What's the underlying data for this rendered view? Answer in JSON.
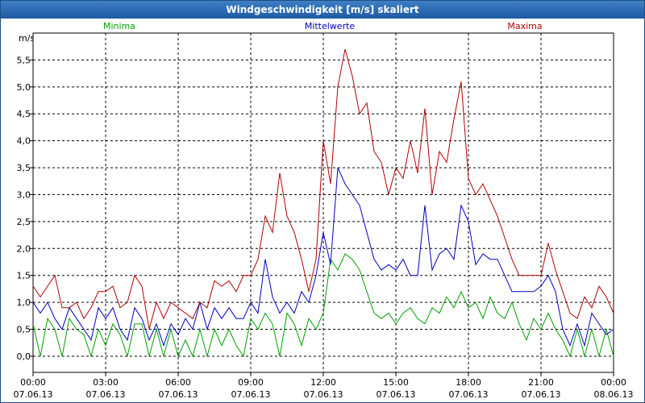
{
  "window": {
    "title": "Windgeschwindigkeit [m/s] skaliert"
  },
  "chart_data": {
    "type": "line",
    "title": "Windgeschwindigkeit [m/s] skaliert",
    "ylabel": "m/s",
    "ylim": [
      -0.3,
      6.0
    ],
    "y_ticks": [
      "0,0",
      "0,5",
      "1,0",
      "1,5",
      "2,0",
      "2,5",
      "3,0",
      "3,5",
      "4,0",
      "4,5",
      "5,0",
      "5,5"
    ],
    "y_tick_values": [
      0,
      0.5,
      1,
      1.5,
      2,
      2.5,
      3,
      3.5,
      4,
      4.5,
      5,
      5.5
    ],
    "x_ticks": [
      {
        "hours": 0,
        "time": "00:00",
        "date": "07.06.13"
      },
      {
        "hours": 3,
        "time": "03:00",
        "date": "07.06.13"
      },
      {
        "hours": 6,
        "time": "06:00",
        "date": "07.06.13"
      },
      {
        "hours": 9,
        "time": "09:00",
        "date": "07.06.13"
      },
      {
        "hours": 12,
        "time": "12:00",
        "date": "07.06.13"
      },
      {
        "hours": 15,
        "time": "15:00",
        "date": "07.06.13"
      },
      {
        "hours": 18,
        "time": "18:00",
        "date": "07.06.13"
      },
      {
        "hours": 21,
        "time": "21:00",
        "date": "07.06.13"
      },
      {
        "hours": 24,
        "time": "00:00",
        "date": "08.06.13"
      }
    ],
    "xlim": [
      0,
      24
    ],
    "grid": true,
    "legend_position": "top",
    "series": [
      {
        "name": "Minima",
        "color": "#00a000",
        "points": [
          [
            0,
            0.6
          ],
          [
            0.3,
            0
          ],
          [
            0.6,
            0.7
          ],
          [
            0.9,
            0.5
          ],
          [
            1.2,
            0
          ],
          [
            1.5,
            0.7
          ],
          [
            1.8,
            0.5
          ],
          [
            2.1,
            0.4
          ],
          [
            2.4,
            0
          ],
          [
            2.7,
            0.5
          ],
          [
            3,
            0.2
          ],
          [
            3.3,
            0.6
          ],
          [
            3.6,
            0.4
          ],
          [
            3.9,
            0
          ],
          [
            4.2,
            0.6
          ],
          [
            4.5,
            0.6
          ],
          [
            4.8,
            0
          ],
          [
            5.1,
            0.5
          ],
          [
            5.4,
            0
          ],
          [
            5.7,
            0.5
          ],
          [
            6,
            0
          ],
          [
            6.3,
            0.3
          ],
          [
            6.6,
            0
          ],
          [
            6.9,
            0.5
          ],
          [
            7.2,
            0
          ],
          [
            7.5,
            0.5
          ],
          [
            7.8,
            0.2
          ],
          [
            8.1,
            0.5
          ],
          [
            8.4,
            0.2
          ],
          [
            8.7,
            0
          ],
          [
            9,
            0.7
          ],
          [
            9.3,
            0.5
          ],
          [
            9.6,
            0.8
          ],
          [
            9.9,
            0.6
          ],
          [
            10.2,
            0
          ],
          [
            10.5,
            0.8
          ],
          [
            10.8,
            0.6
          ],
          [
            11.1,
            0.2
          ],
          [
            11.4,
            0.7
          ],
          [
            11.7,
            0.5
          ],
          [
            12,
            0.8
          ],
          [
            12.3,
            1.8
          ],
          [
            12.6,
            1.6
          ],
          [
            12.9,
            1.9
          ],
          [
            13.2,
            1.8
          ],
          [
            13.5,
            1.6
          ],
          [
            13.8,
            1.2
          ],
          [
            14.1,
            0.8
          ],
          [
            14.4,
            0.7
          ],
          [
            14.7,
            0.8
          ],
          [
            15,
            0.6
          ],
          [
            15.3,
            0.8
          ],
          [
            15.6,
            0.9
          ],
          [
            15.9,
            0.7
          ],
          [
            16.2,
            0.6
          ],
          [
            16.5,
            0.9
          ],
          [
            16.8,
            0.8
          ],
          [
            17.1,
            1.1
          ],
          [
            17.4,
            0.9
          ],
          [
            17.7,
            1.2
          ],
          [
            18,
            0.9
          ],
          [
            18.3,
            1.0
          ],
          [
            18.6,
            0.7
          ],
          [
            18.9,
            1.1
          ],
          [
            19.2,
            0.8
          ],
          [
            19.5,
            0.7
          ],
          [
            19.8,
            1.0
          ],
          [
            20.1,
            0.6
          ],
          [
            20.4,
            0.3
          ],
          [
            20.7,
            0.7
          ],
          [
            21,
            0.5
          ],
          [
            21.3,
            0.8
          ],
          [
            21.6,
            0.5
          ],
          [
            21.9,
            0.3
          ],
          [
            22.2,
            0
          ],
          [
            22.5,
            0.5
          ],
          [
            22.8,
            0
          ],
          [
            23.1,
            0.5
          ],
          [
            23.4,
            0
          ],
          [
            23.7,
            0.5
          ],
          [
            24,
            0
          ]
        ]
      },
      {
        "name": "Mittelwerte",
        "color": "#0000c0",
        "points": [
          [
            0,
            1.0
          ],
          [
            0.3,
            0.8
          ],
          [
            0.6,
            1.0
          ],
          [
            0.9,
            0.7
          ],
          [
            1.2,
            0.5
          ],
          [
            1.5,
            0.9
          ],
          [
            1.8,
            0.7
          ],
          [
            2.1,
            0.5
          ],
          [
            2.4,
            0.3
          ],
          [
            2.7,
            0.9
          ],
          [
            3,
            0.7
          ],
          [
            3.3,
            0.9
          ],
          [
            3.6,
            0.5
          ],
          [
            3.9,
            0.3
          ],
          [
            4.2,
            0.9
          ],
          [
            4.5,
            0.7
          ],
          [
            4.8,
            0.3
          ],
          [
            5.1,
            0.6
          ],
          [
            5.4,
            0.2
          ],
          [
            5.7,
            0.6
          ],
          [
            6,
            0.4
          ],
          [
            6.3,
            0.7
          ],
          [
            6.6,
            0.5
          ],
          [
            6.9,
            1.0
          ],
          [
            7.2,
            0.5
          ],
          [
            7.5,
            0.9
          ],
          [
            7.8,
            0.7
          ],
          [
            8.1,
            0.9
          ],
          [
            8.4,
            0.7
          ],
          [
            8.7,
            0.7
          ],
          [
            9,
            1.0
          ],
          [
            9.3,
            0.8
          ],
          [
            9.6,
            1.8
          ],
          [
            9.9,
            1.1
          ],
          [
            10.2,
            0.8
          ],
          [
            10.5,
            1.0
          ],
          [
            10.8,
            0.8
          ],
          [
            11.1,
            1.2
          ],
          [
            11.4,
            1.0
          ],
          [
            11.7,
            1.5
          ],
          [
            12,
            2.3
          ],
          [
            12.3,
            1.7
          ],
          [
            12.6,
            3.5
          ],
          [
            12.9,
            3.2
          ],
          [
            13.2,
            3.0
          ],
          [
            13.5,
            2.8
          ],
          [
            13.8,
            2.3
          ],
          [
            14.1,
            1.8
          ],
          [
            14.4,
            1.6
          ],
          [
            14.7,
            1.7
          ],
          [
            15,
            1.6
          ],
          [
            15.3,
            1.8
          ],
          [
            15.6,
            1.5
          ],
          [
            15.9,
            1.5
          ],
          [
            16.2,
            2.8
          ],
          [
            16.5,
            1.6
          ],
          [
            16.8,
            1.9
          ],
          [
            17.1,
            2.0
          ],
          [
            17.4,
            1.8
          ],
          [
            17.7,
            2.8
          ],
          [
            18,
            2.5
          ],
          [
            18.3,
            1.7
          ],
          [
            18.6,
            1.9
          ],
          [
            18.9,
            1.8
          ],
          [
            19.2,
            1.8
          ],
          [
            19.5,
            1.5
          ],
          [
            19.8,
            1.2
          ],
          [
            20.1,
            1.2
          ],
          [
            20.4,
            1.2
          ],
          [
            20.7,
            1.2
          ],
          [
            21,
            1.3
          ],
          [
            21.3,
            1.5
          ],
          [
            21.6,
            1.2
          ],
          [
            21.9,
            0.5
          ],
          [
            22.2,
            0.2
          ],
          [
            22.5,
            0.6
          ],
          [
            22.8,
            0.2
          ],
          [
            23.1,
            0.8
          ],
          [
            23.4,
            0.6
          ],
          [
            23.7,
            0.4
          ],
          [
            24,
            0.5
          ]
        ]
      },
      {
        "name": "Maxima",
        "color": "#b00000",
        "points": [
          [
            0,
            1.3
          ],
          [
            0.3,
            1.1
          ],
          [
            0.6,
            1.3
          ],
          [
            0.9,
            1.5
          ],
          [
            1.2,
            0.9
          ],
          [
            1.5,
            0.9
          ],
          [
            1.8,
            1.0
          ],
          [
            2.1,
            0.7
          ],
          [
            2.4,
            0.9
          ],
          [
            2.7,
            1.2
          ],
          [
            3,
            1.2
          ],
          [
            3.3,
            1.3
          ],
          [
            3.6,
            0.9
          ],
          [
            3.9,
            1.0
          ],
          [
            4.2,
            1.5
          ],
          [
            4.5,
            1.3
          ],
          [
            4.8,
            0.5
          ],
          [
            5.1,
            1.0
          ],
          [
            5.4,
            0.7
          ],
          [
            5.7,
            1.0
          ],
          [
            6,
            0.9
          ],
          [
            6.3,
            0.8
          ],
          [
            6.6,
            0.7
          ],
          [
            6.9,
            1.0
          ],
          [
            7.2,
            0.9
          ],
          [
            7.5,
            1.4
          ],
          [
            7.8,
            1.3
          ],
          [
            8.1,
            1.4
          ],
          [
            8.4,
            1.2
          ],
          [
            8.7,
            1.5
          ],
          [
            9,
            1.5
          ],
          [
            9.3,
            1.8
          ],
          [
            9.6,
            2.6
          ],
          [
            9.9,
            2.3
          ],
          [
            10.2,
            3.4
          ],
          [
            10.5,
            2.6
          ],
          [
            10.8,
            2.3
          ],
          [
            11.1,
            1.8
          ],
          [
            11.4,
            1.2
          ],
          [
            11.7,
            1.8
          ],
          [
            12,
            4.0
          ],
          [
            12.3,
            3.2
          ],
          [
            12.6,
            5.0
          ],
          [
            12.9,
            5.7
          ],
          [
            13.2,
            5.2
          ],
          [
            13.5,
            4.5
          ],
          [
            13.8,
            4.7
          ],
          [
            14.1,
            3.8
          ],
          [
            14.4,
            3.6
          ],
          [
            14.7,
            3.0
          ],
          [
            15,
            3.5
          ],
          [
            15.3,
            3.3
          ],
          [
            15.6,
            4.0
          ],
          [
            15.9,
            3.4
          ],
          [
            16.2,
            4.6
          ],
          [
            16.5,
            3.0
          ],
          [
            16.8,
            3.8
          ],
          [
            17.1,
            3.6
          ],
          [
            17.4,
            4.4
          ],
          [
            17.7,
            5.1
          ],
          [
            18,
            3.3
          ],
          [
            18.3,
            3.0
          ],
          [
            18.6,
            3.2
          ],
          [
            18.9,
            2.9
          ],
          [
            19.2,
            2.6
          ],
          [
            19.5,
            2.2
          ],
          [
            19.8,
            1.8
          ],
          [
            20.1,
            1.5
          ],
          [
            20.4,
            1.5
          ],
          [
            20.7,
            1.5
          ],
          [
            21,
            1.5
          ],
          [
            21.3,
            2.1
          ],
          [
            21.6,
            1.6
          ],
          [
            21.9,
            1.2
          ],
          [
            22.2,
            0.8
          ],
          [
            22.5,
            0.7
          ],
          [
            22.8,
            1.1
          ],
          [
            23.1,
            0.9
          ],
          [
            23.4,
            1.3
          ],
          [
            23.7,
            1.1
          ],
          [
            24,
            0.8
          ]
        ]
      }
    ]
  }
}
